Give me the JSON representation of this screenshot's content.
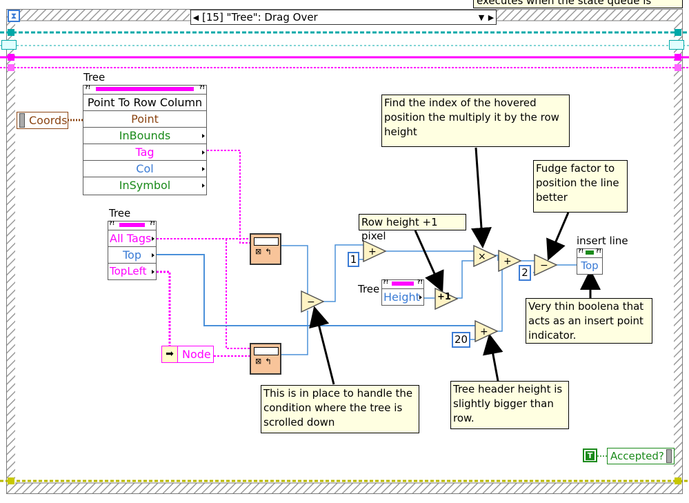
{
  "top_comment": "executes when the state queue is empty",
  "case_selector": {
    "label": "[15] \"Tree\": Drag Over"
  },
  "coords_control": {
    "label": "Coords"
  },
  "tree_property_node": {
    "owner_label": "Tree",
    "method": "Point To Row Column",
    "rows": [
      "Point",
      "InBounds",
      "Tag",
      "Col",
      "InSymbol"
    ]
  },
  "tree_node_2": {
    "owner_label": "Tree",
    "rows": [
      "All Tags",
      "Top",
      "TopLeft"
    ]
  },
  "tree_node_3": {
    "owner_label": "Tree",
    "row": "Height"
  },
  "insert_line_node": {
    "owner_label": "insert line",
    "row": "Top"
  },
  "node_constant": {
    "label": "Node"
  },
  "constants": {
    "one": "1",
    "two": "2",
    "twenty": "20"
  },
  "increment_label": "+1",
  "accepted_indicator": {
    "label": "Accepted?",
    "constant": "T"
  },
  "comments": {
    "find_index": "Find the index of the hovered position the multiply it by the row height",
    "row_height": "Row height +1 pixel",
    "fudge_factor": "Fudge factor to position the line better",
    "thin_boolean": "Very thin boolena that acts as an insert point indicator.",
    "scrolled": "This is in place to handle the condition where the tree is scrolled down",
    "header_height": "Tree header height is slightly bigger than row."
  },
  "colors": {
    "frame": "#8a8a8a",
    "hatch": "#c0c0c0",
    "wire_blue": "#4a90d9",
    "wire_pink": "#ff00ff",
    "wire_cyan": "#00a0a0",
    "wire_yellow": "#c8c800",
    "node_orange": "#f8c49a",
    "prim_fill": "#fff3c4"
  }
}
